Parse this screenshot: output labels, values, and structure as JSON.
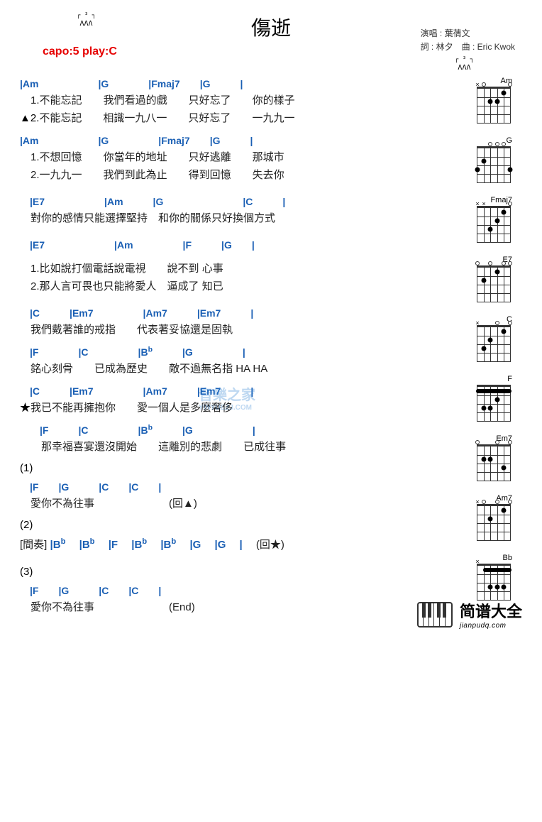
{
  "header": {
    "title": "傷逝",
    "capo": "capo:5 play:C",
    "strum_top": "┌ ³ ┐",
    "strum_arrows": "ΛΛΛ",
    "performer_label": "演唱 : ",
    "performer": "葉蒨文",
    "lyricist_label": "詞 : ",
    "lyricist": "林夕",
    "composer_label": "曲 : ",
    "composer": "Eric Kwok"
  },
  "verse1": {
    "chords": {
      "c1": "Am",
      "c2": "G",
      "c3": "Fmaj7",
      "c4": "G"
    },
    "l1_num": "1.",
    "l1_a": "不能忘記",
    "l1_b": "我們看過的戲",
    "l1_c": "只好忘了",
    "l1_d": "你的樣子",
    "l2_prefix": "▲2.",
    "l2_a": "不能忘記",
    "l2_b": "相識一九八一",
    "l2_c": "只好忘了",
    "l2_d": "一九九一"
  },
  "verse2": {
    "chords": {
      "c1": "Am",
      "c2": "G",
      "c3": "Fmaj7",
      "c4": "G"
    },
    "l1_num": "1.",
    "l1_a": "不想回憶",
    "l1_b": "你當年的地址",
    "l1_c": "只好逃離",
    "l1_d": "那城市",
    "l2_num": "2.",
    "l2_a": "一九九一",
    "l2_b": "我們到此為止",
    "l2_c": "得到回憶",
    "l2_d": "失去你"
  },
  "bridge1": {
    "chords": {
      "c1": "E7",
      "c2": "Am",
      "c3": "G",
      "c4": "C"
    },
    "l1_a": "對你的感情只能選擇堅持",
    "l1_b": "和你的關係只好換個方式"
  },
  "bridge2": {
    "chords": {
      "c1": "E7",
      "c2": "Am",
      "c3": "F",
      "c4": "G"
    },
    "l1_num": "1.",
    "l1": "比如說打個電話說電視　　說不到 心事",
    "l2_num": "2.",
    "l2": "那人言可畏也只能將愛人　逼成了 知已"
  },
  "chorus1": {
    "chords": {
      "c1": "C",
      "c2": "Em7",
      "c3": "Am7",
      "c4": "Em7"
    },
    "l1_a": "我們戴著誰的戒指",
    "l1_b": "代表著妥協還是固執"
  },
  "chorus2": {
    "chords": {
      "c1": "F",
      "c2": "C",
      "c3": "B",
      "c3_flat": "b",
      "c4": "G"
    },
    "l1_a": "銘心刻骨",
    "l1_b": "已成為歷史",
    "l1_c": "敵不過無名指 HA HA"
  },
  "chorus3": {
    "chords": {
      "c1": "C",
      "c2": "Em7",
      "c3": "Am7",
      "c4": "Em7"
    },
    "l1_prefix": "★",
    "l1_a": "我已不能再擁抱你",
    "l1_b": "愛一個人是多麼奢侈"
  },
  "chorus4": {
    "chords": {
      "c1": "F",
      "c2": "C",
      "c3": "B",
      "c3_flat": "b",
      "c4": "G"
    },
    "l1_a": "那幸福喜宴還沒開始",
    "l1_b": "這離別的悲劇",
    "l1_c": "已成往事"
  },
  "ending1": {
    "num": "(1)",
    "chords": {
      "c1": "F",
      "c2": "G",
      "c3": "C",
      "c4": "C"
    },
    "l1_a": "愛你不為往事",
    "goto": "(回▲)"
  },
  "ending2": {
    "num": "(2)",
    "label": "[間奏]",
    "chords": {
      "c1": "B",
      "c1_flat": "b",
      "c2": "B",
      "c2_flat": "b",
      "c3": "F",
      "c4": "B",
      "c4_flat": "b",
      "c5": "B",
      "c5_flat": "b",
      "c6": "G",
      "c7": "G"
    },
    "goto": "(回★)"
  },
  "ending3": {
    "num": "(3)",
    "chords": {
      "c1": "F",
      "c2": "G",
      "c3": "C",
      "c4": "C"
    },
    "l1_a": "愛你不為往事",
    "end": "(End)"
  },
  "diagrams": {
    "d1": "Am",
    "d2": "G",
    "d3": "Fmaj7",
    "d4": "E7",
    "d5": "C",
    "d6": "F",
    "d7": "Em7",
    "d8": "Am7",
    "d9": "Bb"
  },
  "watermark": {
    "main": "音樂之家",
    "sub": "YINYUEZJ.COM"
  },
  "footer": {
    "main": "简谱大全",
    "sub": "jianpudq.com"
  }
}
